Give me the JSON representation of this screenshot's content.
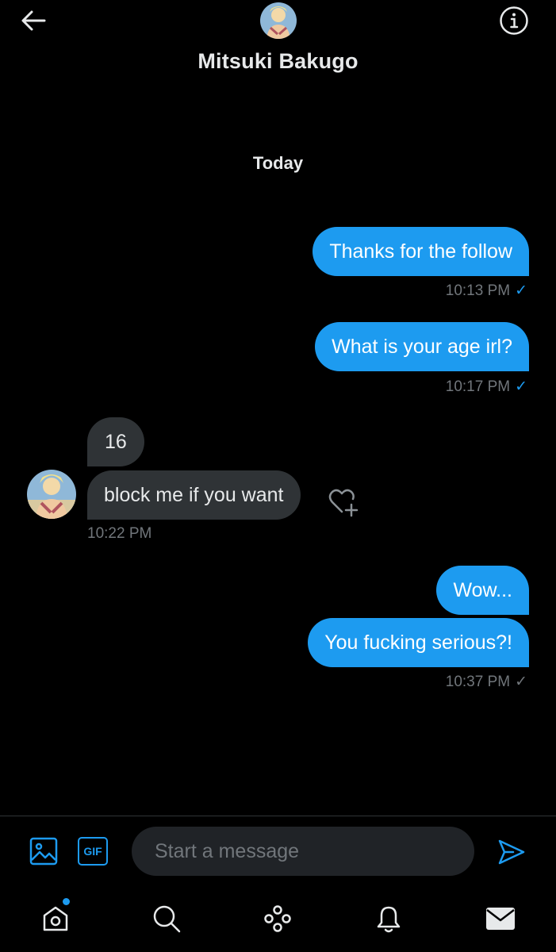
{
  "header": {
    "contact_name": "Mitsuki Bakugo",
    "back_icon": "arrow-left-icon",
    "info_icon": "info-circle-icon"
  },
  "conversation": {
    "date_label": "Today",
    "messages": [
      {
        "direction": "sent",
        "text": "Thanks for the follow",
        "time": "10:13 PM",
        "status": "read"
      },
      {
        "direction": "sent",
        "text": "What is your age irl?",
        "time": "10:17 PM",
        "status": "read"
      },
      {
        "direction": "received",
        "text": "16"
      },
      {
        "direction": "received",
        "text": "block me if you want",
        "time": "10:22 PM"
      },
      {
        "direction": "sent",
        "text": "Wow..."
      },
      {
        "direction": "sent",
        "text": "You fucking serious?!",
        "time": "10:37 PM",
        "status": "sent"
      }
    ],
    "check_glyph": "✓"
  },
  "composer": {
    "placeholder": "Start a message",
    "gif_label": "GIF",
    "media_icon": "image-icon",
    "send_icon": "send-icon"
  },
  "nav": {
    "items": [
      "home-icon",
      "search-icon",
      "spaces-icon",
      "notifications-icon",
      "messages-icon"
    ]
  },
  "colors": {
    "accent": "#1d9bf0",
    "background": "#000000",
    "received_bubble": "#2f3336",
    "muted_text": "#71767b"
  }
}
